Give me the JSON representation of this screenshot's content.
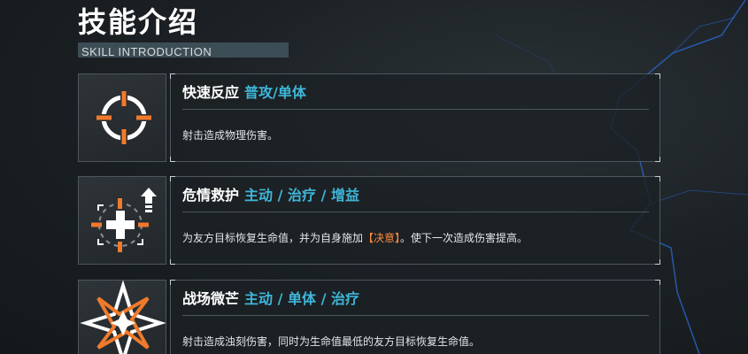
{
  "header": {
    "title": "技能介绍",
    "subtitle": "SKILL INTRODUCTION"
  },
  "colors": {
    "accent_orange": "#f07a2c",
    "tag_blue": "#3fb6d8",
    "keyword_orange": "#ff8a3c"
  },
  "skills": [
    {
      "icon": "crosshair-icon",
      "name": "快速反应",
      "tags": "普攻/单体",
      "desc_pre": "射击造成物理伤害。",
      "desc_keyword": "",
      "desc_post": ""
    },
    {
      "icon": "heal-buff-icon",
      "name": "危情救护",
      "tags": "主动 / 治疗 / 增益",
      "desc_pre": "为友方目标恢复生命值，并为自身施加",
      "desc_keyword": "【决意】",
      "desc_post": "。使下一次造成伤害提高。"
    },
    {
      "icon": "star-burst-icon",
      "name": "战场微芒",
      "tags": "主动 / 单体 / 治疗",
      "desc_pre": "射击造成浊刻伤害，同时为生命值最低的友方目标恢复生命值。",
      "desc_keyword": "",
      "desc_post": ""
    }
  ]
}
